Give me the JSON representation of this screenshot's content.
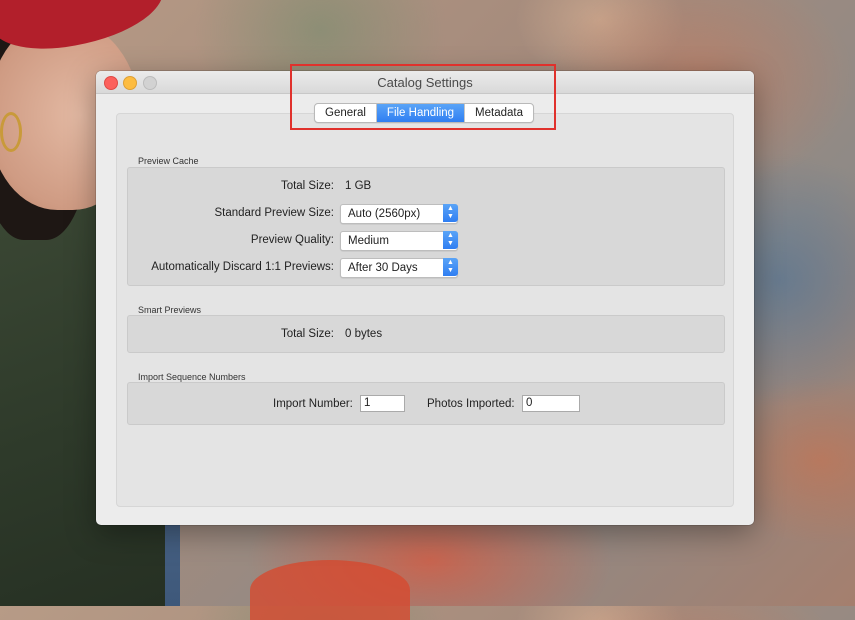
{
  "window": {
    "title": "Catalog Settings"
  },
  "tabs": [
    {
      "label": "General",
      "active": false
    },
    {
      "label": "File Handling",
      "active": true
    },
    {
      "label": "Metadata",
      "active": false
    }
  ],
  "preview_cache": {
    "heading": "Preview Cache",
    "total_size_label": "Total Size:",
    "total_size_value": "1 GB",
    "standard_preview_size_label": "Standard Preview Size:",
    "standard_preview_size_value": "Auto (2560px)",
    "preview_quality_label": "Preview Quality:",
    "preview_quality_value": "Medium",
    "discard_label": "Automatically Discard 1:1 Previews:",
    "discard_value": "After 30 Days"
  },
  "smart_previews": {
    "heading": "Smart Previews",
    "total_size_label": "Total Size:",
    "total_size_value": "0 bytes"
  },
  "import_sequence": {
    "heading": "Import Sequence Numbers",
    "import_number_label": "Import Number:",
    "import_number_value": "1",
    "photos_imported_label": "Photos Imported:",
    "photos_imported_value": "0"
  },
  "colors": {
    "accent": "#2f7ef2",
    "highlight_box": "#e0312c",
    "close": "#fc605c",
    "minimize": "#fdbc40",
    "maximize": "#d2d2d2"
  }
}
